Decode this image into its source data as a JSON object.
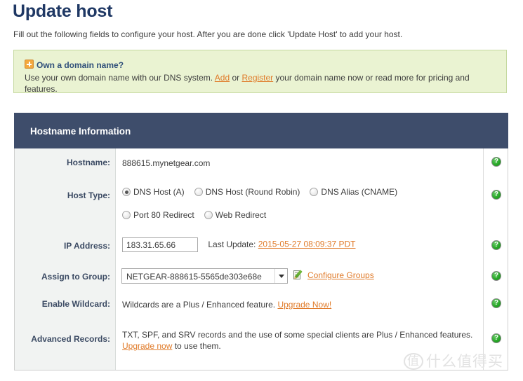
{
  "page": {
    "title": "Update host",
    "subtitle": "Fill out the following fields to configure your host. After you are done click 'Update Host' to add your host."
  },
  "notice": {
    "icon": "plus-expand-icon",
    "title": "Own a domain name?",
    "body_part1": "Use your own domain name with our DNS system. ",
    "link_add": "Add",
    "body_or": " or ",
    "link_register": "Register",
    "body_part2": " your domain name now or read more for pricing and features.",
    "bg_color": "#eaf3d2",
    "border_color": "#c5d9a0"
  },
  "panel": {
    "header_title": "Hostname Information",
    "header_bg": "#3e4d6b",
    "label_column_bg": "#f1f3f2"
  },
  "rows": {
    "hostname": {
      "label": "Hostname:",
      "value": "888615.mynetgear.com",
      "help": "?"
    },
    "host_type": {
      "label": "Host Type:",
      "help": "?",
      "options": [
        {
          "label": "DNS Host (A)",
          "selected": true
        },
        {
          "label": "DNS Host (Round Robin)",
          "selected": false
        },
        {
          "label": "DNS Alias (CNAME)",
          "selected": false
        },
        {
          "label": "Port 80 Redirect",
          "selected": false
        },
        {
          "label": "Web Redirect",
          "selected": false
        }
      ]
    },
    "ip_address": {
      "label": "IP Address:",
      "value": "183.31.65.66",
      "placeholder": "",
      "last_update_label": "Last Update: ",
      "last_update_value": "2015-05-27 08:09:37 PDT",
      "help": "?"
    },
    "assign_group": {
      "label": "Assign to Group:",
      "selected": "NETGEAR-888615-5565de303e68e",
      "options": [
        "NETGEAR-888615-5565de303e68e"
      ],
      "configure_link": "Configure Groups",
      "configure_icon": "configure-groups-icon",
      "help": "?"
    },
    "enable_wildcard": {
      "label": "Enable Wildcard:",
      "text": "Wildcards are a Plus / Enhanced feature. ",
      "link": "Upgrade Now!",
      "help": "?"
    },
    "advanced_records": {
      "label": "Advanced Records:",
      "text_part1": "TXT, SPF, and SRV records and the use of some special clients are Plus / Enhanced features. ",
      "link": "Upgrade now",
      "text_part2": " to use them.",
      "help": "?"
    }
  },
  "watermark": {
    "mark": "值",
    "text": "什么值得买"
  },
  "colors": {
    "title": "#1f3864",
    "link": "#e07b2a",
    "panel_header": "#3e4d6b",
    "help_green": "#26a626"
  }
}
